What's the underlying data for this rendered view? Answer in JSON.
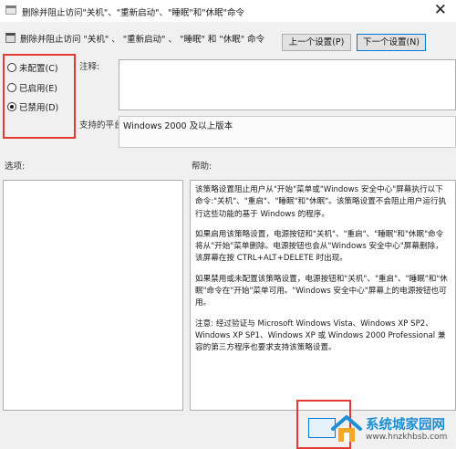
{
  "window": {
    "title": "删除并阻止访问\"关机\"、\"重新启动\"、\"睡眠\"和\"休眠\"命令",
    "close_glyph": "✕"
  },
  "header": {
    "policy_title": "删除并阻止访问 \"关机\" 、 \"重新启动\" 、 \"睡眠\" 和 \"休眠\" 命令",
    "prev_button": "上一个设置(P)",
    "next_button": "下一个设置(N)"
  },
  "options": {
    "not_configured": "未配置(C)",
    "enabled": "已启用(E)",
    "disabled": "已禁用(D)",
    "selected": "disabled"
  },
  "comment_label": "注释:",
  "platform": {
    "label": "支持的平台:",
    "value": "Windows 2000 及以上版本"
  },
  "options_label": "选项:",
  "help": {
    "label": "帮助:",
    "paragraphs": [
      "该策略设置阻止用户从\"开始\"菜单或\"Windows 安全中心\"屏幕执行以下命令:\"关机\"、\"重启\"、\"睡眠\"和\"休眠\"。该策略设置不会阻止用户运行执行这些功能的基于 Windows 的程序。",
      "如果启用该策略设置，电源按钮和\"关机\"、\"重启\"、\"睡眠\"和\"休眠\"命令将从\"开始\"菜单删除。电源按钮也会从\"Windows 安全中心\"屏幕删除，该屏幕在按 CTRL+ALT+DELETE 时出现。",
      "如果禁用或未配置该策略设置，电源按钮和\"关机\"、\"重启\"、\"睡眠\"和\"休眠\"命令在\"开始\"菜单可用。\"Windows 安全中心\"屏幕上的电源按钮也可用。",
      "注意: 经过验证与 Microsoft Windows Vista、Windows XP SP2、Windows XP SP1、Windows XP 或 Windows 2000 Professional 兼容的第三方程序也要求支持该策略设置。"
    ]
  },
  "watermark": {
    "name": "系统城家园网",
    "url": "www.hnzkhbsb.com"
  },
  "colors": {
    "highlight": "#e53935",
    "accent": "#0078d7",
    "watermark": "#1e8fd6"
  }
}
